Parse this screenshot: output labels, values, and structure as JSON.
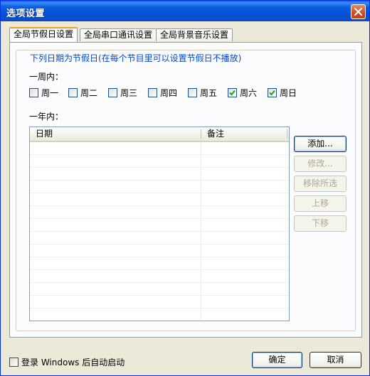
{
  "window": {
    "title": "选项设置"
  },
  "tabs": [
    {
      "label": "全局节假日设置",
      "active": true
    },
    {
      "label": "全局串口通讯设置",
      "active": false
    },
    {
      "label": "全局背景音乐设置",
      "active": false
    }
  ],
  "group": {
    "legend": "下列日期为节假日(在每个节目里可以设置节假日不播放)"
  },
  "week": {
    "label": "一周内：",
    "days": [
      {
        "label": "周一",
        "checked": false
      },
      {
        "label": "周二",
        "checked": false
      },
      {
        "label": "周三",
        "checked": false
      },
      {
        "label": "周四",
        "checked": false
      },
      {
        "label": "周五",
        "checked": false
      },
      {
        "label": "周六",
        "checked": true
      },
      {
        "label": "周日",
        "checked": true
      }
    ]
  },
  "year": {
    "label": "一年内：",
    "columns": [
      "日期",
      "备注"
    ]
  },
  "actions": {
    "add": "添加...",
    "edit": "修改...",
    "remove": "移除所选",
    "up": "上移",
    "down": "下移"
  },
  "autostart": {
    "label": "登录 Windows 后自动启动",
    "checked": false
  },
  "footer": {
    "ok": "确定",
    "cancel": "取消"
  }
}
